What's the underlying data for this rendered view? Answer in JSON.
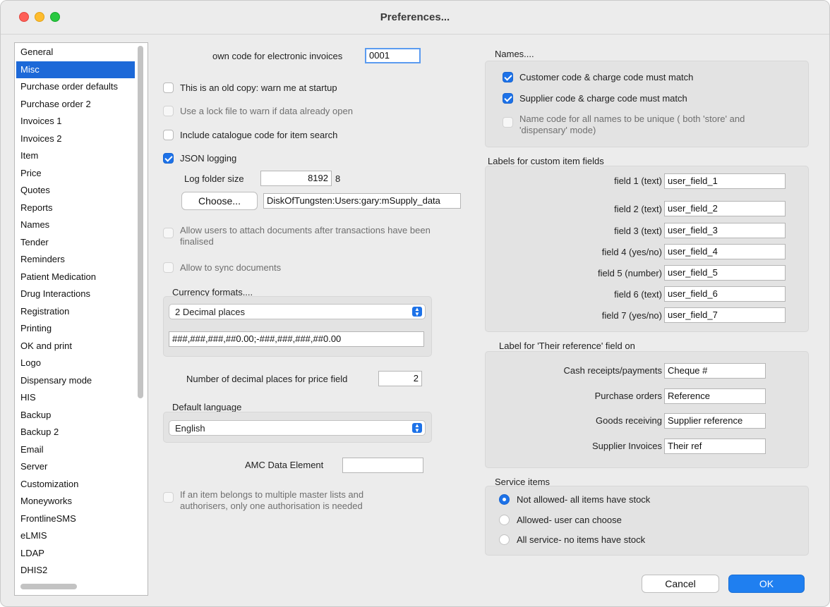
{
  "window": {
    "title": "Preferences..."
  },
  "sidebar": {
    "items": [
      {
        "label": "General"
      },
      {
        "label": "Misc"
      },
      {
        "label": "Purchase order defaults"
      },
      {
        "label": "Purchase order 2"
      },
      {
        "label": "Invoices 1"
      },
      {
        "label": "Invoices 2"
      },
      {
        "label": "Item"
      },
      {
        "label": "Price"
      },
      {
        "label": "Quotes"
      },
      {
        "label": "Reports"
      },
      {
        "label": "Names"
      },
      {
        "label": "Tender"
      },
      {
        "label": "Reminders"
      },
      {
        "label": "Patient Medication"
      },
      {
        "label": "Drug Interactions"
      },
      {
        "label": "Registration"
      },
      {
        "label": "Printing"
      },
      {
        "label": "OK and print"
      },
      {
        "label": "Logo"
      },
      {
        "label": "Dispensary mode"
      },
      {
        "label": "HIS"
      },
      {
        "label": "Backup"
      },
      {
        "label": "Backup 2"
      },
      {
        "label": "Email"
      },
      {
        "label": "Server"
      },
      {
        "label": "Customization"
      },
      {
        "label": "Moneyworks"
      },
      {
        "label": "FrontlineSMS"
      },
      {
        "label": "eLMIS"
      },
      {
        "label": "LDAP"
      },
      {
        "label": "DHIS2"
      }
    ],
    "selected": "Misc"
  },
  "misc": {
    "own_code_label": "own code for electronic invoices",
    "own_code_value": "0001",
    "old_copy_label": "This is an old copy: warn me at startup",
    "lock_file_label": "Use a lock file to warn if data already open",
    "catalogue_label": "Include catalogue code for item search",
    "json_logging_label": "JSON logging",
    "log_folder_label": "Log folder size",
    "log_folder_value": "8192",
    "log_folder_unit": "8",
    "choose_button": "Choose...",
    "path_value": "DiskOfTungsten:Users:gary:mSupply_data",
    "attach_docs_label": "Allow users to attach documents after transactions have been finalised",
    "sync_docs_label": "Allow to sync documents",
    "currency_title": "Currency formats....",
    "currency_select": "2 Decimal places",
    "currency_format": "###,###,###,##0.00;-###,###,###,##0.00",
    "decimal_places_label": "Number of decimal places for price field",
    "decimal_places_value": "2",
    "language_title": "Default language",
    "language_select": "English",
    "amc_label": "AMC Data Element",
    "amc_value": "",
    "master_lists_label": "If an item belongs to multiple master lists and authorisers, only one authorisation is needed"
  },
  "names": {
    "title": "Names....",
    "customer_match": "Customer code & charge code must match",
    "supplier_match": "Supplier code & charge code must match",
    "unique_code": "Name code for all names to be unique ( both 'store' and 'dispensary' mode)"
  },
  "custom_fields": {
    "title": "Labels for custom item fields",
    "fields": [
      {
        "label": "field 1 (text)",
        "value": "user_field_1"
      },
      {
        "label": "field 2 (text)",
        "value": "user_field_2"
      },
      {
        "label": "field 3 (text)",
        "value": "user_field_3"
      },
      {
        "label": "field 4 (yes/no)",
        "value": "user_field_4"
      },
      {
        "label": "field 5 (number)",
        "value": "user_field_5"
      },
      {
        "label": "field 6 (text)",
        "value": "user_field_6"
      },
      {
        "label": "field 7 (yes/no)",
        "value": "user_field_7"
      }
    ]
  },
  "their_reference": {
    "title": "Label for 'Their reference' field on",
    "rows": [
      {
        "label": "Cash receipts/payments",
        "value": "Cheque #"
      },
      {
        "label": "Purchase orders",
        "value": "Reference"
      },
      {
        "label": "Goods receiving",
        "value": "Supplier reference"
      },
      {
        "label": "Supplier Invoices",
        "value": "Their ref"
      }
    ]
  },
  "service_items": {
    "title": "Service items",
    "options": [
      {
        "label": "Not allowed- all items have stock"
      },
      {
        "label": "Allowed- user can choose"
      },
      {
        "label": "All service- no items have stock"
      }
    ],
    "selected": "Not allowed- all items have stock"
  },
  "footer": {
    "cancel": "Cancel",
    "ok": "OK"
  },
  "colors": {
    "accent": "#1d72e8",
    "selection": "#1d69d8"
  }
}
